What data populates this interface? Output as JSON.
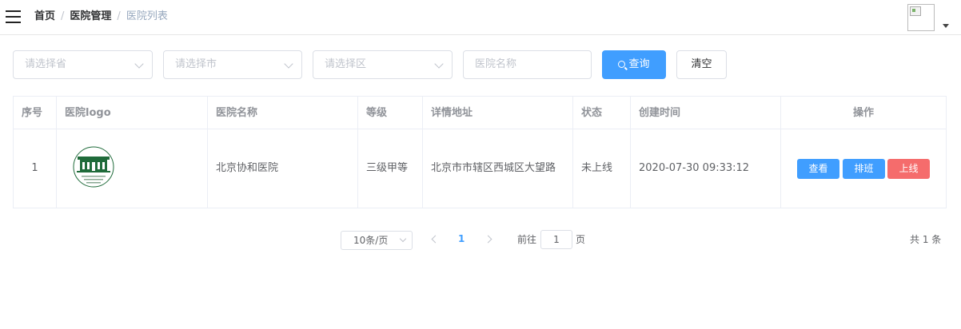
{
  "header": {
    "breadcrumb": [
      "首页",
      "医院管理",
      "医院列表"
    ],
    "separator": "/"
  },
  "filters": {
    "province_placeholder": "请选择省",
    "city_placeholder": "请选择市",
    "district_placeholder": "请选择区",
    "name_placeholder": "医院名称",
    "search_label": "查询",
    "clear_label": "清空"
  },
  "table": {
    "headers": [
      "序号",
      "医院logo",
      "医院名称",
      "等级",
      "详情地址",
      "状态",
      "创建时间",
      "操作"
    ],
    "rows": [
      {
        "index": "1",
        "name": "北京协和医院",
        "level": "三级甲等",
        "address": "北京市市辖区西城区大望路",
        "status": "未上线",
        "created": "2020-07-30 09:33:12",
        "actions": [
          "查看",
          "排班",
          "上线"
        ]
      }
    ]
  },
  "pagination": {
    "page_size": "10条/页",
    "current": "1",
    "goto_prefix": "前往",
    "goto_value": "1",
    "goto_suffix": "页",
    "total": "共 1 条"
  },
  "colors": {
    "primary": "#409eff",
    "danger": "#f56c6c",
    "logo_green": "#1f6b3a"
  }
}
